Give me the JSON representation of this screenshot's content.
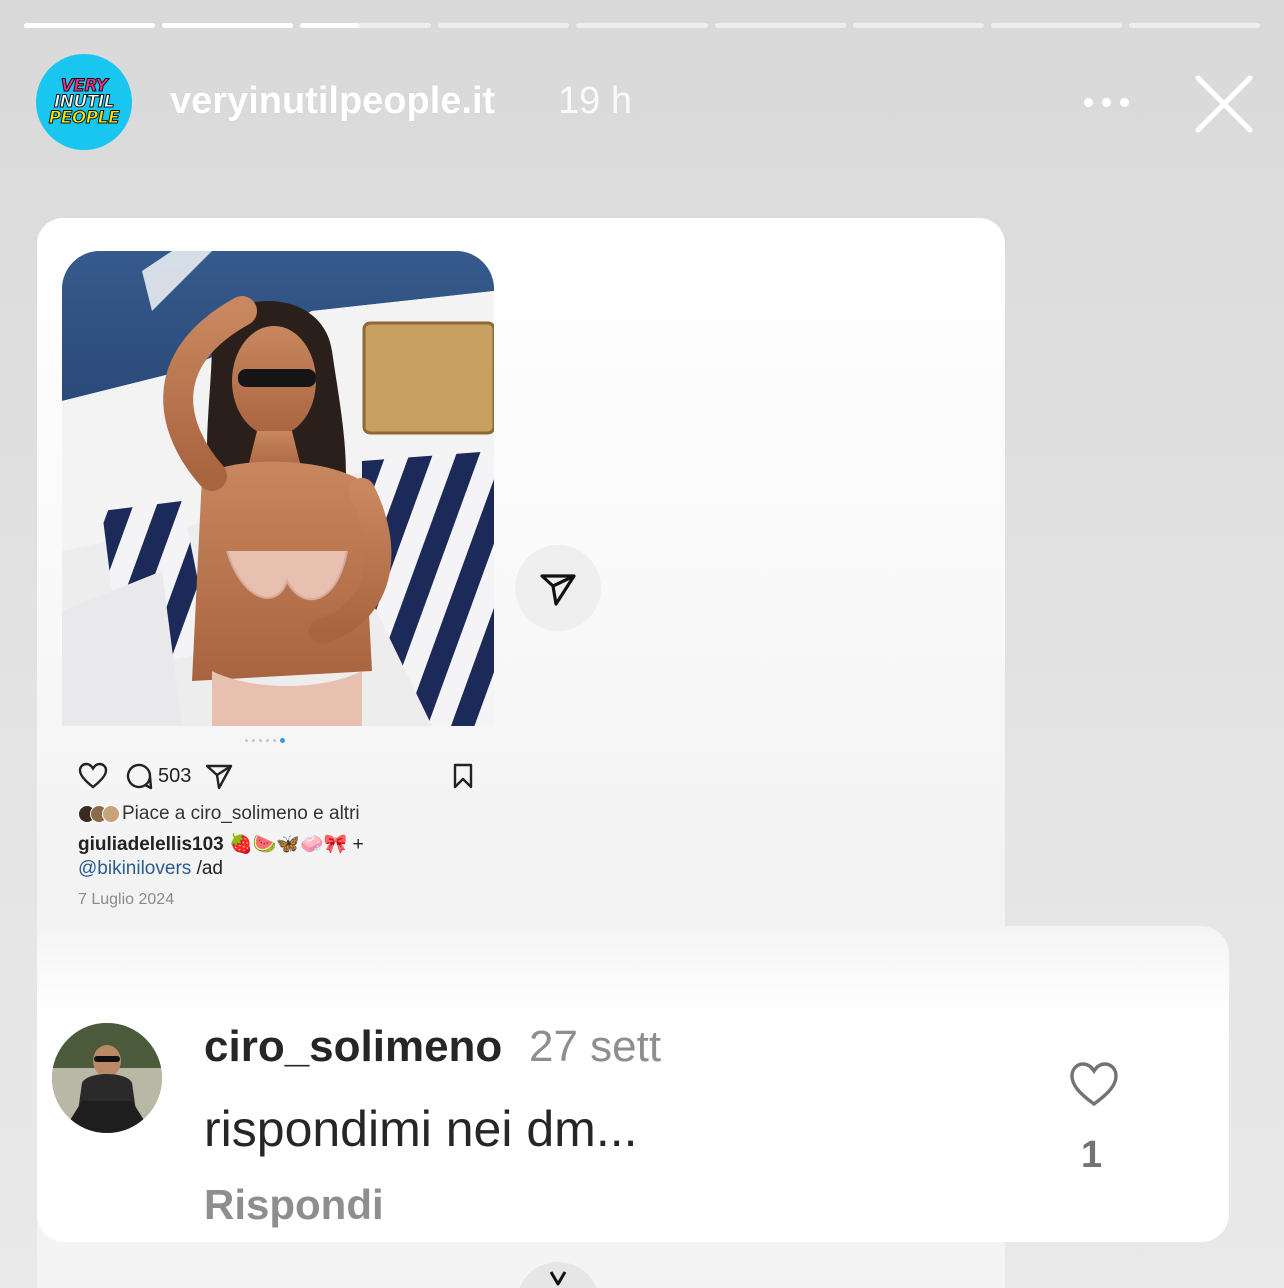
{
  "story": {
    "progress_segments": 9,
    "current_segment": 3,
    "current_segment_fill": 0.45
  },
  "header": {
    "avatar_lines": [
      "VERY",
      "INUTIL",
      "PEOPLE"
    ],
    "username": "veryinutilpeople.it",
    "time": "19 h",
    "more_icon": "ellipsis-icon",
    "close_icon": "close-icon"
  },
  "post": {
    "comment_count": "503",
    "likes_text": "Piace a ciro_solimeno e altri",
    "caption_user": "giuliadelellis103",
    "caption_emojis": "🍓🍉🦋🧼🎀",
    "caption_plus": "+",
    "mention": "@bikinilovers",
    "ad_tag": "/ad",
    "date": "7 Luglio 2024",
    "carousel_dots": 6,
    "carousel_active": 6,
    "icons": [
      "heart-icon",
      "comment-icon",
      "share-icon",
      "bookmark-icon"
    ]
  },
  "comment": {
    "username": "ciro_solimeno",
    "time": "27 sett",
    "text": "rispondimi nei dm...",
    "reply_label": "Rispondi",
    "likes": "1"
  },
  "colors": {
    "avatar_bg": "#18c6f0",
    "mention": "#2a5c8e",
    "carousel_active": "#3897f0"
  }
}
